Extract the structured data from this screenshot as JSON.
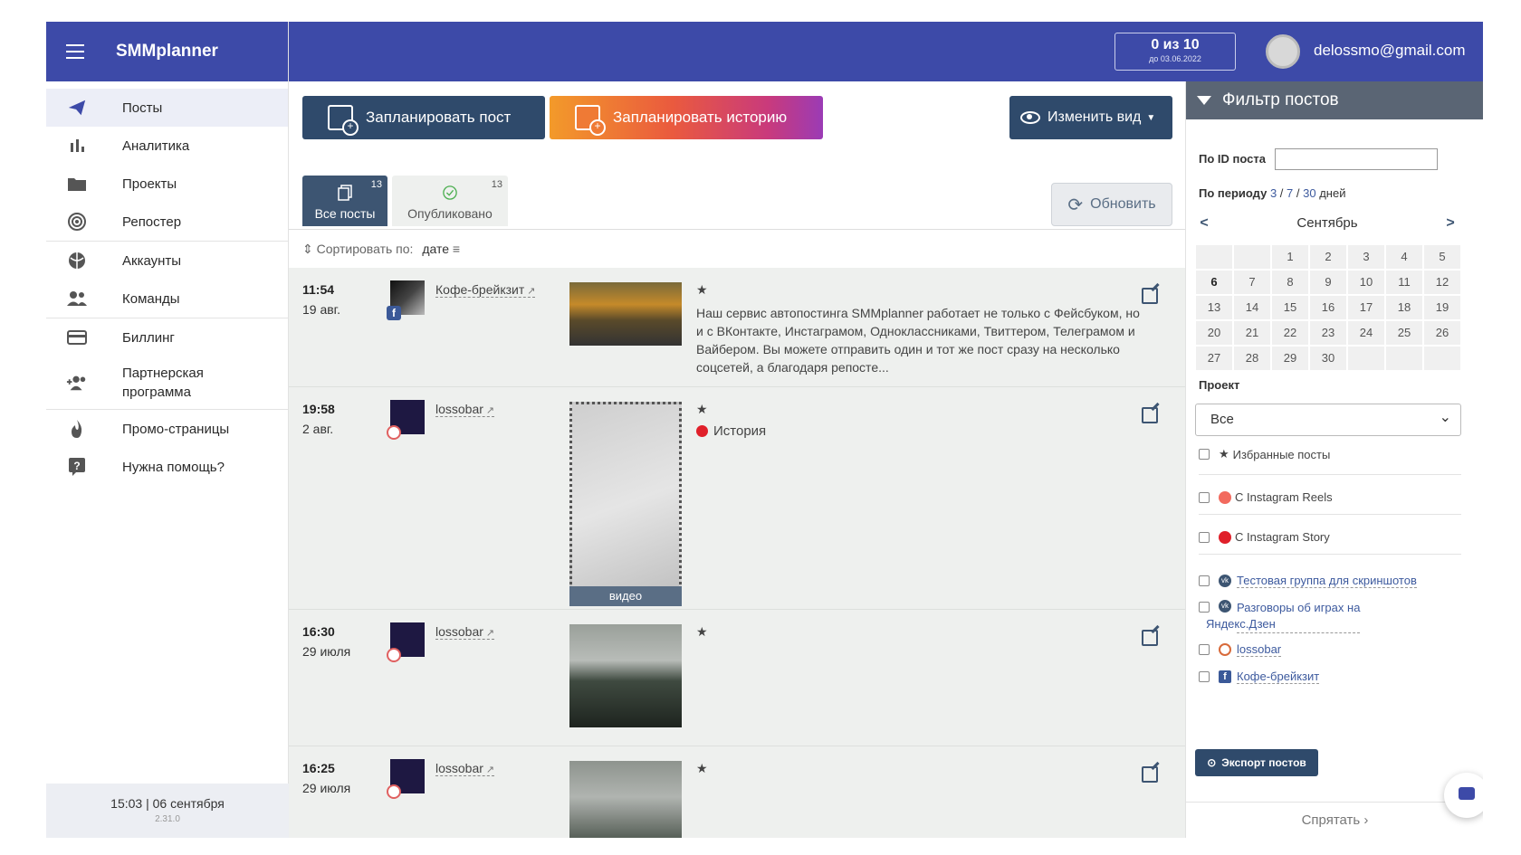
{
  "sidebar": {
    "brand": "SMMplanner",
    "items": [
      {
        "label": "Посты",
        "icon": "send-icon"
      },
      {
        "label": "Аналитика",
        "icon": "bar-chart-icon"
      },
      {
        "label": "Проекты",
        "icon": "folder-icon"
      },
      {
        "label": "Репостер",
        "icon": "broadcast-icon"
      },
      {
        "label": "Аккаунты",
        "icon": "globe-icon"
      },
      {
        "label": "Команды",
        "icon": "people-icon"
      },
      {
        "label": "Биллинг",
        "icon": "credit-card-icon"
      },
      {
        "label_line1": "Партнерская",
        "label_line2": "программа",
        "icon": "add-group-icon"
      },
      {
        "label": "Промо-страницы",
        "icon": "flame-icon"
      },
      {
        "label": "Нужна помощь?",
        "icon": "help-icon"
      }
    ],
    "footer_time": "15:03  |  06 сентября",
    "footer_version": "2.31.0"
  },
  "topbar": {
    "quota_main": "0 из 10",
    "quota_sub": "до 03.06.2022",
    "email": "delossmo@gmail.com"
  },
  "toolbar": {
    "plan_post": "Запланировать пост",
    "plan_story": "Запланировать историю",
    "change_view": "Изменить вид",
    "refresh": "Обновить"
  },
  "tabs": [
    {
      "label": "Все посты",
      "count": "13"
    },
    {
      "label": "Опубликовано",
      "count": "13"
    }
  ],
  "sort": {
    "label": "Сортировать по:",
    "value": "дате"
  },
  "posts": [
    {
      "time": "11:54",
      "date": "19 авг.",
      "account": "Кофе-брейкзит",
      "star": "★",
      "text": "Наш сервис автопостинга SMMplanner работает не только с Фейсбуком, но и с ВКонтакте, Инстаграмом, Одноклассниками, Твиттером, Телеграмом и Вайбером. Вы можете отправить один и тот же пост сразу на несколько соцсетей, а благодаря репосте..."
    },
    {
      "time": "19:58",
      "date": "2 авг.",
      "account": "lossobar",
      "star": "★",
      "story": "История",
      "video_label": "видео"
    },
    {
      "time": "16:30",
      "date": "29 июля",
      "account": "lossobar",
      "star": "★"
    },
    {
      "time": "16:25",
      "date": "29 июля",
      "account": "lossobar",
      "star": "★"
    }
  ],
  "filter": {
    "title": "Фильтр постов",
    "id_label": "По ID поста",
    "period_label": "По периоду",
    "period_3": "3",
    "period_7": "7",
    "period_30": "30",
    "period_unit": "дней",
    "month": "Сентябрь",
    "days": [
      "",
      "",
      "1",
      "2",
      "3",
      "4",
      "5",
      "6",
      "7",
      "8",
      "9",
      "10",
      "11",
      "12",
      "13",
      "14",
      "15",
      "16",
      "17",
      "18",
      "19",
      "20",
      "21",
      "22",
      "23",
      "24",
      "25",
      "26",
      "27",
      "28",
      "29",
      "30",
      "",
      "",
      ""
    ],
    "project_label": "Проект",
    "project_value": "Все",
    "favorites": "Избранные посты",
    "reels": "С Instagram Reels",
    "story": "С Instagram Story",
    "accounts": [
      {
        "label": "Тестовая группа для скриншотов",
        "icon": "vk-icon"
      },
      {
        "label_line1": "Разговоры об играх на",
        "label_line2": "Яндекс.Дзен",
        "icon": "vk-icon"
      },
      {
        "label": "lossobar",
        "icon": "instagram-icon"
      },
      {
        "label": "Кофе-брейкзит",
        "icon": "facebook-icon"
      }
    ],
    "export": "Экспорт постов",
    "hide": "Спрятать"
  },
  "colors": {
    "brand": "#3d4aa8",
    "button": "#2f4a6b",
    "story_dot": "#e0202a"
  }
}
